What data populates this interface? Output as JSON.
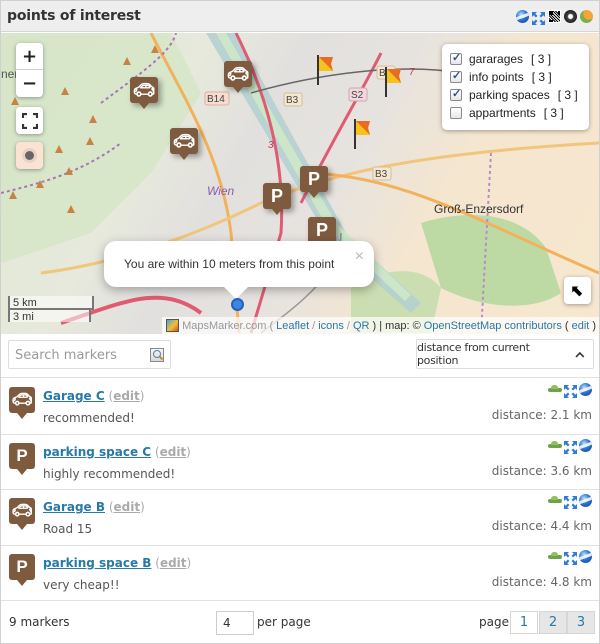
{
  "header": {
    "title": "points of interest",
    "icons": [
      "google-earth-icon",
      "fullscreen-icon",
      "qr-code-icon",
      "wikitude-icon",
      "rss-icon"
    ]
  },
  "map": {
    "controls": {
      "zoom_in": "+",
      "zoom_out": "−",
      "fullscreen": "fullscreen-icon",
      "locate": "locate-icon",
      "reset": "⬉"
    },
    "layers": [
      {
        "label": "gararages",
        "count": "[ 3 ]",
        "checked": true
      },
      {
        "label": "info points",
        "count": "[ 3 ]",
        "checked": true
      },
      {
        "label": "parking spaces",
        "count": "[ 3 ]",
        "checked": true
      },
      {
        "label": "appartments",
        "count": "[ 3 ]",
        "checked": false
      }
    ],
    "labels": {
      "city": "Wien",
      "town": "Groß-Enzersdorf",
      "partial": "ner",
      "roads": [
        "B14",
        "B3",
        "B8",
        "S2",
        "B3",
        "7",
        "3"
      ]
    },
    "popup": {
      "text": "You are within 10 meters from this point",
      "close": "×"
    },
    "scale": {
      "km": "5 km",
      "mi": "3 mi"
    },
    "attribution": {
      "mapsmarker": "MapsMarker.com",
      "open_paren": "(",
      "leaflet": "Leaflet",
      "icons": "icons",
      "qr": "QR",
      "mid": ") | map: ©",
      "osm": "OpenStreetMap contributors",
      "edit_open": "(",
      "edit": "edit",
      "edit_close": ")"
    }
  },
  "search": {
    "placeholder": "Search markers"
  },
  "sort": {
    "label": "distance from current position",
    "icon": "chevron-up-icon"
  },
  "markers": [
    {
      "icon": "car",
      "name": "Garage C",
      "edit": "edit",
      "description": "recommended!",
      "distance": "distance: 2.1 km"
    },
    {
      "icon": "parking",
      "name": "parking space C",
      "edit": "edit",
      "description": "highly recommended!",
      "distance": "distance: 3.6 km"
    },
    {
      "icon": "car",
      "name": "Garage B",
      "edit": "edit",
      "description": "Road 15",
      "distance": "distance: 4.4 km"
    },
    {
      "icon": "parking",
      "name": "parking space B",
      "edit": "edit",
      "description": "very cheap!!",
      "distance": "distance: 4.8 km"
    }
  ],
  "footer": {
    "count": "9 markers",
    "per_page_value": "4",
    "per_page_label": "per page",
    "page_label": "page",
    "pages": [
      "1",
      "2",
      "3"
    ],
    "current_page": "1"
  }
}
